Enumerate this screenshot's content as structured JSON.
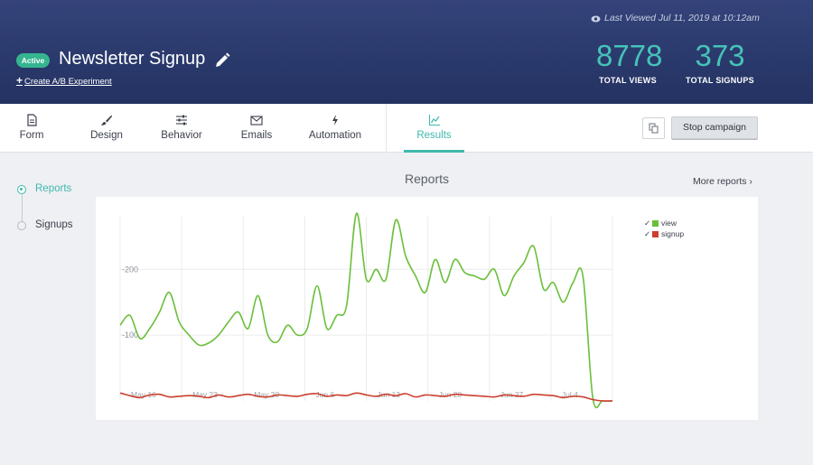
{
  "header": {
    "status_badge": "Active",
    "title": "Newsletter Signup",
    "create_ab_label": "Create A/B Experiment",
    "last_viewed": "Last Viewed Jul 11, 2019 at 10:12am",
    "stats": [
      {
        "value": "8778",
        "label": "TOTAL VIEWS"
      },
      {
        "value": "373",
        "label": "TOTAL SIGNUPS"
      }
    ]
  },
  "tabs": [
    {
      "label": "Form",
      "icon": "form-icon"
    },
    {
      "label": "Design",
      "icon": "brush-icon"
    },
    {
      "label": "Behavior",
      "icon": "sliders-icon"
    },
    {
      "label": "Emails",
      "icon": "envelope-icon"
    },
    {
      "label": "Automation",
      "icon": "lightning-icon"
    },
    {
      "label": "Results",
      "icon": "line-chart-icon",
      "active": true
    }
  ],
  "actions": {
    "copy_icon": "copy-icon",
    "stop_label": "Stop campaign"
  },
  "left_nav": [
    {
      "label": "Reports",
      "active": true
    },
    {
      "label": "Signups",
      "active": false
    }
  ],
  "reports": {
    "title": "Reports",
    "more_label": "More reports ›"
  },
  "colors": {
    "accent": "#3fb8ad",
    "badge": "#35b58f",
    "view_series": "#6abf3a",
    "signup_series": "#cc3f2e",
    "header_top": "#34437a",
    "header_bottom": "#233261"
  },
  "chart_data": {
    "type": "line",
    "x_tick_labels": [
      "May 16",
      "May 23",
      "May 30",
      "Jun 6",
      "Jun 13",
      "Jun 20",
      "Jun 27",
      "Jul 4"
    ],
    "y_tick_labels": [
      "100",
      "200"
    ],
    "ylim": [
      0,
      280
    ],
    "grid": true,
    "legend_position": "top-right",
    "x_start_date": "2019-05-13",
    "series": [
      {
        "name": "view",
        "color": "#6abf3a",
        "values": [
          115,
          130,
          95,
          110,
          135,
          165,
          120,
          100,
          85,
          88,
          100,
          120,
          135,
          110,
          160,
          100,
          90,
          115,
          100,
          110,
          175,
          110,
          130,
          145,
          285,
          185,
          200,
          185,
          275,
          220,
          190,
          165,
          215,
          180,
          215,
          195,
          190,
          185,
          200,
          160,
          190,
          210,
          235,
          170,
          180,
          150,
          180,
          190,
          5,
          0,
          0
        ]
      },
      {
        "name": "signup",
        "color": "#cc3f2e",
        "values": [
          12,
          8,
          5,
          9,
          10,
          6,
          7,
          8,
          7,
          5,
          9,
          6,
          8,
          10,
          7,
          6,
          9,
          8,
          7,
          10,
          11,
          7,
          9,
          8,
          12,
          9,
          7,
          10,
          8,
          11,
          6,
          9,
          8,
          7,
          10,
          9,
          8,
          7,
          6,
          9,
          8,
          7,
          10,
          9,
          8,
          5,
          7,
          6,
          2,
          0,
          0
        ]
      }
    ]
  }
}
